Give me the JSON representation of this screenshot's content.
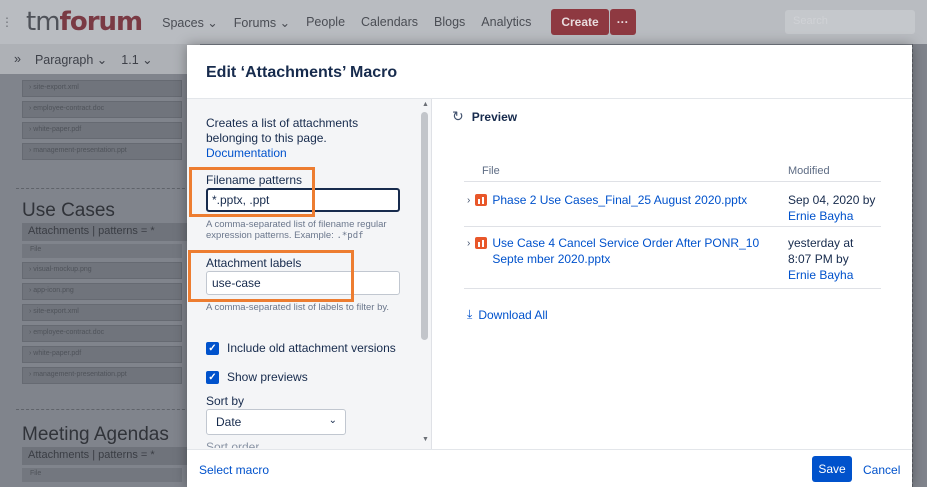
{
  "topbar": {
    "logo_pre": "tm",
    "logo_post": "forum",
    "nav": [
      "Spaces ⌄",
      "Forums ⌄",
      "People",
      "Calendars",
      "Blogs",
      "Analytics"
    ],
    "create_label": "Create",
    "more_label": "···",
    "search_placeholder": "Search"
  },
  "editor_toolbar": {
    "collapse": "»",
    "paragraph": "Paragraph ⌄",
    "numbering": "1.1 ⌄"
  },
  "background_page": {
    "top_files": [
      "site-export.xml",
      "employee-contract.doc",
      "white-paper.pdf",
      "management-presentation.ppt"
    ],
    "heading1": "Use Cases",
    "attachments_bar1": "Attachments | patterns = *",
    "col_file": "File",
    "mid_files": [
      "visual-mockup.png",
      "app-icon.png",
      "site-export.xml",
      "employee-contract.doc",
      "white-paper.pdf",
      "management-presentation.ppt"
    ],
    "heading2": "Meeting Agendas",
    "attachments_bar2": "Attachments | patterns = *",
    "col_file2": "File"
  },
  "modal": {
    "title": "Edit ‘Attachments’ Macro",
    "description": "Creates a list of attachments belonging to this page.",
    "documentation_link": "Documentation",
    "filename_patterns_label": "Filename patterns",
    "filename_patterns_value": "*.pptx, .ppt",
    "filename_help_prefix": "A comma-separated list of filename regular expression patterns. Example: ",
    "filename_help_example": ".*pdf",
    "attachment_labels_label": "Attachment labels",
    "attachment_labels_value": "use-case",
    "labels_help": "A comma-separated list of labels to filter by.",
    "include_old_label": "Include old attachment versions",
    "show_previews_label": "Show previews",
    "sort_by_label": "Sort by",
    "sort_by_value": "Date",
    "sort_order_label": "Sort order",
    "preview_label": "Preview",
    "table": {
      "col_file": "File",
      "col_modified": "Modified",
      "rows": [
        {
          "name": "Phase 2 Use Cases_Final_25 August 2020.pptx",
          "modified": "Sep 04, 2020 by",
          "author": "Ernie Bayha"
        },
        {
          "name": "Use Case 4 Cancel Service Order After PONR_10 Septe mber 2020.pptx",
          "modified": "yesterday at 8:07 PM by",
          "author": "Ernie Bayha"
        }
      ]
    },
    "download_all": "Download All",
    "select_macro": "Select macro",
    "save": "Save",
    "cancel": "Cancel"
  },
  "colors": {
    "accent_blue": "#0052cc",
    "highlight_orange": "#ed7d31",
    "ppt_orange": "#e8572a",
    "create_red": "#8e3941"
  }
}
